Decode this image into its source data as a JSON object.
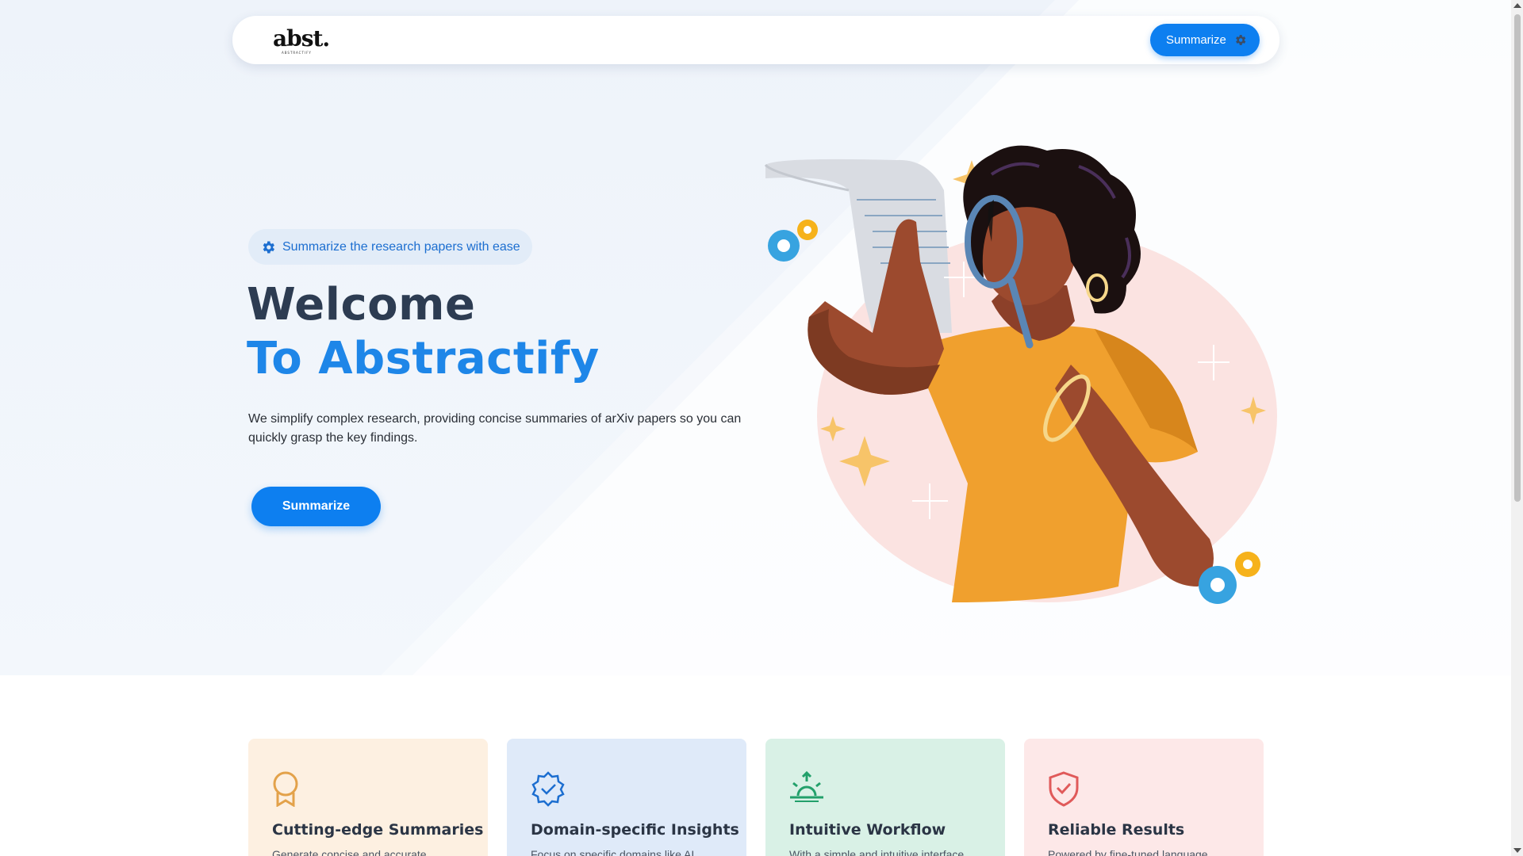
{
  "header": {
    "logo_text": "abst.",
    "logo_subtext": "ABSTRACTIFY",
    "summarize_label": "Summarize"
  },
  "hero": {
    "tag_text": "Summarize the research papers with ease",
    "title_line1": "Welcome",
    "title_line2": "To Abstractify",
    "description": "We simplify complex research, providing concise summaries of arXiv papers so you can quickly grasp the key findings.",
    "cta_label": "Summarize"
  },
  "features": [
    {
      "title": "Cutting-edge Summaries",
      "desc": "Generate concise and accurate",
      "icon": "badge-icon",
      "color": "#e3a24a"
    },
    {
      "title": "Domain-specific Insights",
      "desc": "Focus on specific domains like AI",
      "icon": "verified-badge-icon",
      "color": "#1c6ed0"
    },
    {
      "title": "Intuitive Workflow",
      "desc": "With a simple and intuitive interface",
      "icon": "sunrise-icon",
      "color": "#22a06b"
    },
    {
      "title": "Reliable Results",
      "desc": "Powered by fine-tuned language",
      "icon": "shield-check-icon",
      "color": "#e05a5a"
    }
  ],
  "colors": {
    "primary": "#0d7ff0",
    "title_dark": "#2d3c52",
    "title_blue": "#1e86e8"
  }
}
